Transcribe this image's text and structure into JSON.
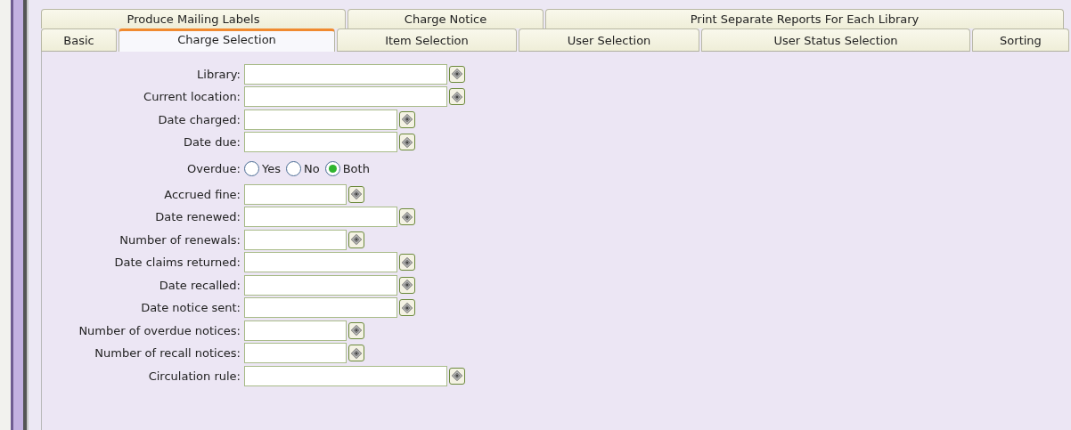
{
  "tab_rows": [
    [
      {
        "label": "Produce Mailing Labels",
        "selected": false
      },
      {
        "label": "Charge Notice",
        "selected": false
      },
      {
        "label": "Print Separate Reports For Each Library",
        "selected": false
      }
    ],
    [
      {
        "label": "Basic",
        "selected": false
      },
      {
        "label": "Charge Selection",
        "selected": true
      },
      {
        "label": "Item Selection",
        "selected": false
      },
      {
        "label": "User Selection",
        "selected": false
      },
      {
        "label": "User Status Selection",
        "selected": false
      },
      {
        "label": "Sorting",
        "selected": false
      }
    ]
  ],
  "fields": [
    {
      "kind": "long",
      "label": "Library:"
    },
    {
      "kind": "long",
      "label": "Current location:"
    },
    {
      "kind": "date",
      "label": "Date charged:"
    },
    {
      "kind": "date",
      "label": "Date due:"
    },
    {
      "kind": "radio",
      "label": "Overdue:",
      "options": [
        {
          "label": "Yes",
          "selected": false
        },
        {
          "label": "No",
          "selected": false
        },
        {
          "label": "Both",
          "selected": true
        }
      ]
    },
    {
      "kind": "number",
      "label": "Accrued fine:"
    },
    {
      "kind": "date",
      "label": "Date renewed:"
    },
    {
      "kind": "number",
      "label": "Number of renewals:"
    },
    {
      "kind": "date",
      "label": "Date claims returned:"
    },
    {
      "kind": "date",
      "label": "Date recalled:"
    },
    {
      "kind": "date",
      "label": "Date notice sent:"
    },
    {
      "kind": "number",
      "label": "Number of overdue notices:"
    },
    {
      "kind": "number",
      "label": "Number of recall notices:"
    },
    {
      "kind": "long",
      "label": "Circulation rule:"
    }
  ]
}
